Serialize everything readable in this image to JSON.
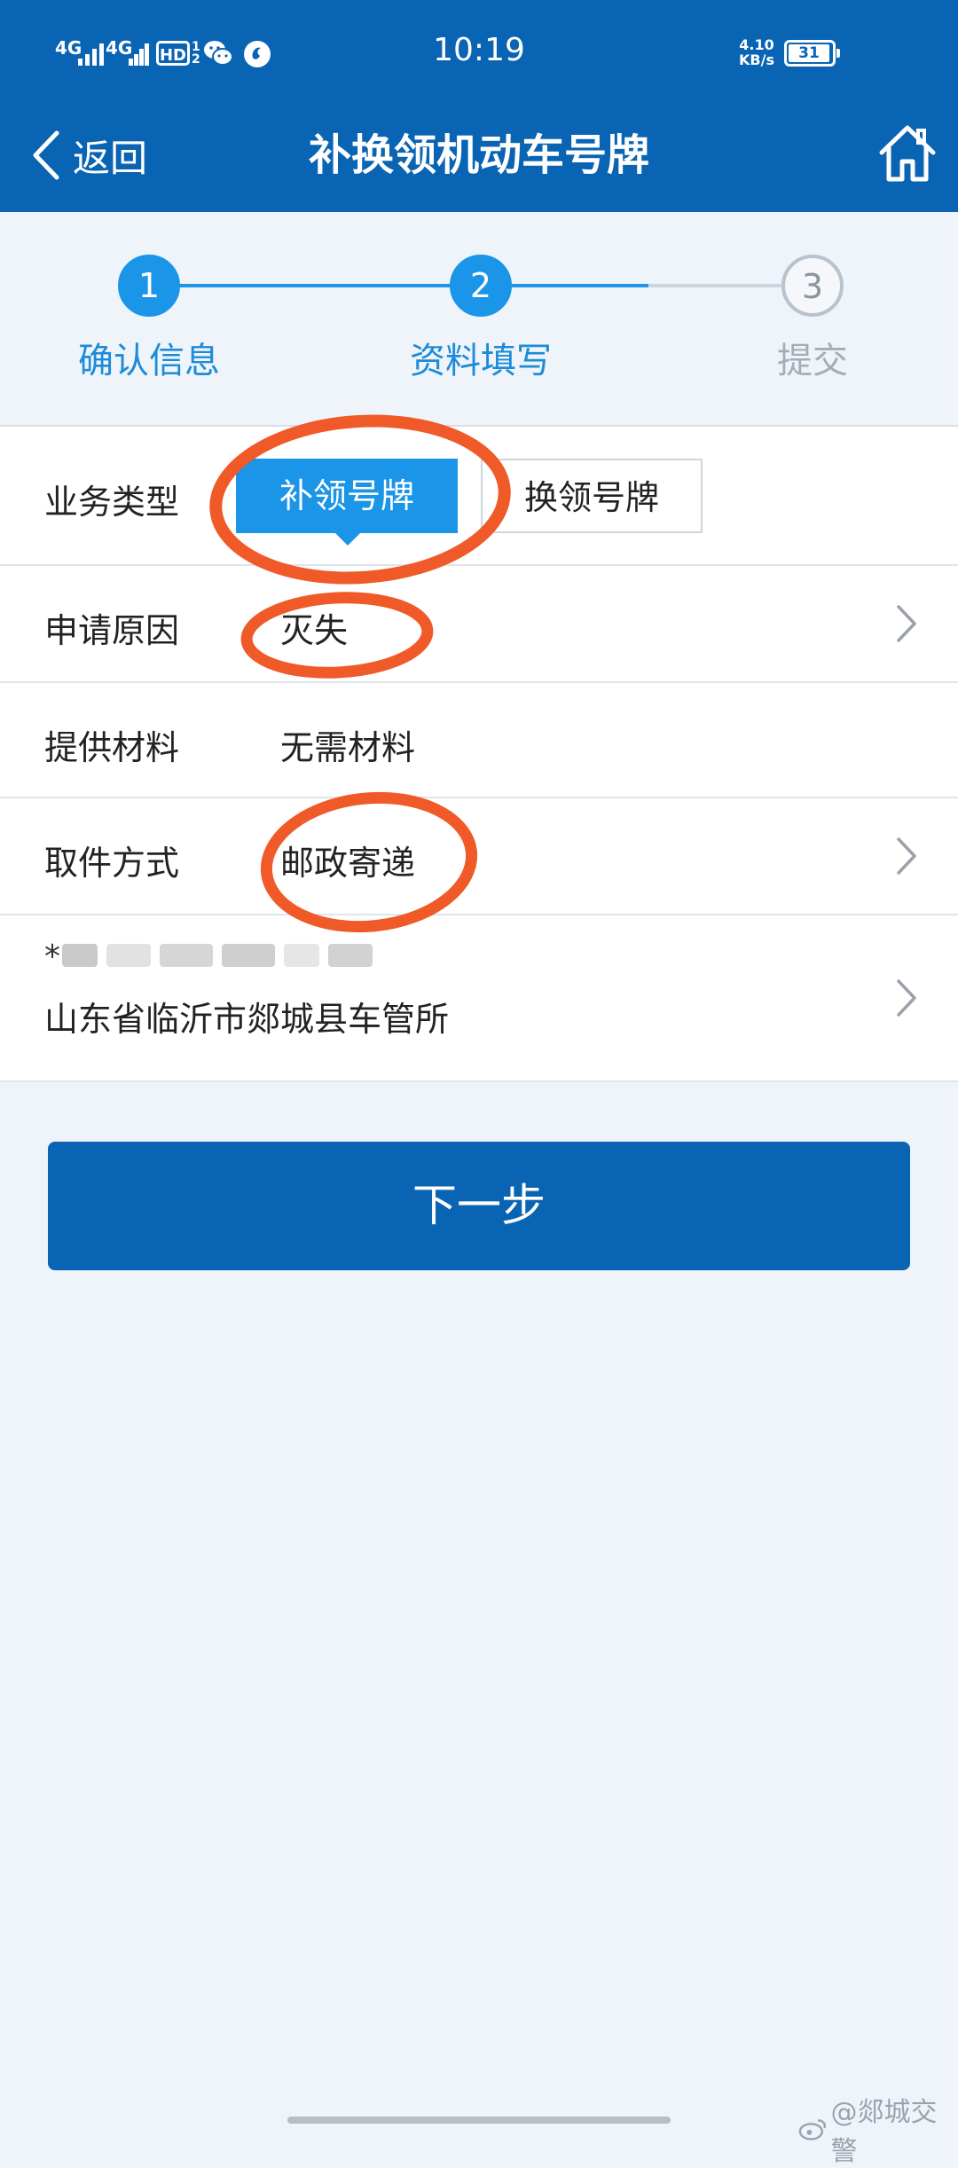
{
  "status_bar": {
    "signal1": "4G",
    "signal2": "4G",
    "hd": "HD",
    "hd_sub_top": "1",
    "hd_sub_bottom": "2",
    "time": "10:19",
    "speed_value": "4.10",
    "speed_unit": "KB/s",
    "battery": "31"
  },
  "header": {
    "back_label": "返回",
    "title": "补换领机动车号牌",
    "home_icon": "home-icon",
    "background": "#0a64b4"
  },
  "steps": [
    {
      "number": "1",
      "label": "确认信息",
      "state": "done"
    },
    {
      "number": "2",
      "label": "资料填写",
      "state": "current"
    },
    {
      "number": "3",
      "label": "提交",
      "state": "pending"
    }
  ],
  "form": {
    "business_type": {
      "label": "业务类型",
      "options": [
        "补领号牌",
        "换领号牌"
      ],
      "selected": "补领号牌"
    },
    "reason": {
      "label": "申请原因",
      "value": "灭失"
    },
    "materials": {
      "label": "提供材料",
      "value": "无需材料"
    },
    "pickup": {
      "label": "取件方式",
      "value": "邮政寄递"
    },
    "address": {
      "prefix": "*",
      "address_line": "山东省临沂市郯城县车管所"
    }
  },
  "next_button": {
    "label": "下一步"
  },
  "watermark": {
    "text": "@郯城交警"
  },
  "colors": {
    "primary": "#0a64b4",
    "accent": "#1a95e8",
    "annotation": "#f05a28"
  }
}
